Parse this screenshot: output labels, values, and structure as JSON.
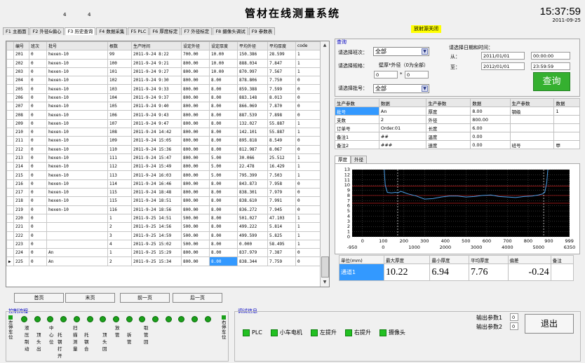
{
  "app": {
    "title": "管材在线测量系统",
    "time": "15:37:59",
    "date": "2011-09-25",
    "marks": [
      "4",
      "4"
    ],
    "radiation_status": "放射源关闭"
  },
  "tabs": [
    "F1 主画面",
    "F2 外径&偏心",
    "F3 历史查询",
    "F4 数据采集",
    "F5 PLC",
    "F6 厚度标定",
    "F7 外径标定",
    "F8 摄像头调试",
    "F9 参数表"
  ],
  "active_tab": 2,
  "grid": {
    "headers": [
      "编号",
      "班次",
      "批号",
      "根数",
      "生产时间",
      "设定外径",
      "设定厚度",
      "平均外径",
      "平均厚度",
      "code"
    ],
    "rows": [
      [
        "201",
        "0",
        "hexen-10",
        "99",
        "2011-9-24 8:22",
        "700.00",
        "10.00",
        "150.386",
        "28.599",
        "1"
      ],
      [
        "202",
        "0",
        "hexen-10",
        "100",
        "2011-9-24 9:21",
        "800.00",
        "10.00",
        "888.034",
        "7.847",
        "1"
      ],
      [
        "203",
        "0",
        "hexen-10",
        "101",
        "2011-9-24 9:27",
        "800.00",
        "10.00",
        "870.997",
        "7.567",
        "1"
      ],
      [
        "204",
        "0",
        "hexen-10",
        "102",
        "2011-9-24 9:30",
        "800.00",
        "8.00",
        "878.806",
        "7.750",
        "0"
      ],
      [
        "205",
        "0",
        "hexen-10",
        "103",
        "2011-9-24 9:33",
        "800.00",
        "8.00",
        "859.388",
        "7.599",
        "0"
      ],
      [
        "206",
        "0",
        "hexen-10",
        "104",
        "2011-9-24 9:37",
        "800.00",
        "8.00",
        "883.148",
        "8.013",
        "0"
      ],
      [
        "207",
        "0",
        "hexen-10",
        "105",
        "2011-9-24 9:40",
        "800.00",
        "8.00",
        "866.069",
        "7.870",
        "0"
      ],
      [
        "208",
        "0",
        "hexen-10",
        "106",
        "2011-9-24 9:43",
        "800.00",
        "8.00",
        "887.539",
        "7.898",
        "0"
      ],
      [
        "209",
        "0",
        "hexen-10",
        "107",
        "2011-9-24 9:47",
        "800.00",
        "8.00",
        "132.027",
        "55.887",
        "1"
      ],
      [
        "210",
        "0",
        "hexen-10",
        "108",
        "2011-9-24 14:42",
        "800.00",
        "8.00",
        "142.101",
        "55.887",
        "1"
      ],
      [
        "211",
        "0",
        "hexen-10",
        "109",
        "2011-9-24 15:05",
        "800.00",
        "8.00",
        "895.818",
        "8.549",
        "0"
      ],
      [
        "212",
        "0",
        "hexen-10",
        "110",
        "2011-9-24 15:36",
        "800.00",
        "8.00",
        "812.987",
        "8.067",
        "0"
      ],
      [
        "213",
        "0",
        "hexen-10",
        "111",
        "2011-9-24 15:47",
        "800.00",
        "5.00",
        "30.066",
        "25.512",
        "1"
      ],
      [
        "214",
        "0",
        "hexen-10",
        "112",
        "2011-9-24 15:49",
        "800.00",
        "5.00",
        "22.478",
        "16.429",
        "1"
      ],
      [
        "215",
        "0",
        "hexen-10",
        "113",
        "2011-9-24 16:03",
        "800.00",
        "5.00",
        "795.399",
        "7.503",
        "1"
      ],
      [
        "216",
        "0",
        "hexen-10",
        "114",
        "2011-9-24 16:46",
        "800.00",
        "8.00",
        "843.873",
        "7.958",
        "0"
      ],
      [
        "217",
        "0",
        "hexen-10",
        "115",
        "2011-9-24 18:48",
        "800.00",
        "8.00",
        "838.301",
        "7.979",
        "0"
      ],
      [
        "218",
        "0",
        "hexen-10",
        "115",
        "2011-9-24 18:51",
        "800.00",
        "8.00",
        "838.610",
        "7.991",
        "0"
      ],
      [
        "219",
        "0",
        "hexen-10",
        "116",
        "2011-9-24 18:56",
        "800.00",
        "8.00",
        "836.272",
        "7.945",
        "0"
      ],
      [
        "220",
        "0",
        "",
        "1",
        "2011-9-25 14:51",
        "500.00",
        "8.00",
        "501.027",
        "47.103",
        "1"
      ],
      [
        "221",
        "0",
        "",
        "2",
        "2011-9-25 14:56",
        "500.00",
        "8.00",
        "499.222",
        "5.814",
        "1"
      ],
      [
        "222",
        "0",
        "",
        "3",
        "2011-9-25 14:59",
        "500.00",
        "8.00",
        "499.599",
        "5.825",
        "1"
      ],
      [
        "223",
        "0",
        "",
        "4",
        "2011-9-25 15:02",
        "500.00",
        "8.00",
        "0.000",
        "58.495",
        "1"
      ],
      [
        "224",
        "0",
        "An",
        "1",
        "2011-9-25 15:29",
        "800.00",
        "8.00",
        "837.979",
        "7.387",
        "0"
      ],
      [
        "225",
        "0",
        "An",
        "2",
        "2011-9-25 15:34",
        "800.00",
        "8.00",
        "838.344",
        "7.759",
        "0"
      ]
    ],
    "current_indicator": "▶",
    "scroll_up": "▲",
    "scroll_down": "▼"
  },
  "pager": [
    "首页",
    "末页",
    "前一页",
    "后一页"
  ],
  "query": {
    "title": "查询",
    "shift_label": "请选择班次：",
    "shift_value": "全部",
    "spec_label": "请选择规格：",
    "spec_hint": "壁厚*外径（0为全部）",
    "spec_thickness": "0",
    "spec_times": "*",
    "spec_diameter": "0",
    "batch_label": "请选择批号：",
    "batch_value": "全部",
    "dropdown_icon": "▼",
    "date_label": "请选择日期和时间：",
    "from_label": "从：",
    "to_label": "至：",
    "from_date": "2011/01/01",
    "from_time": "00:00:00",
    "to_date": "2012/01/01",
    "to_time": "23:59:59",
    "button": "查询"
  },
  "params": {
    "headers": [
      "生产参数",
      "数据",
      "生产参数",
      "数据",
      "生产参数",
      "数据"
    ],
    "rows": [
      [
        "批号",
        "An",
        "厚度",
        "8.00",
        "钢级",
        "1"
      ],
      [
        "支数",
        "2",
        "外径",
        "800.00",
        "",
        ""
      ],
      [
        "订单号",
        "Order.01",
        "长度",
        "6.00",
        "",
        ""
      ],
      [
        "备注1",
        "##",
        "温度",
        "0.00",
        "",
        ""
      ],
      [
        "备注2",
        "###",
        "速度",
        "0.00",
        "班号",
        "甲"
      ]
    ]
  },
  "chart_tabs": [
    "厚度",
    "外径"
  ],
  "chart_data": {
    "type": "line",
    "title": "",
    "xlabel": "",
    "ylabel": "",
    "grid": true,
    "background": "#000000",
    "grid_color": "#808080",
    "line_color": "#4a9fe8",
    "limit_color": "#c02020",
    "xlim": [
      -50,
      1000
    ],
    "ylim": [
      0,
      13
    ],
    "top_ticks": [
      0,
      100,
      200,
      300,
      400,
      500,
      600,
      700,
      800,
      900,
      999
    ],
    "bottom_ticks": [
      "-950",
      "0",
      "1000",
      "2000",
      "3000",
      "4000",
      "5000",
      "6350"
    ],
    "y_ticks": [
      0,
      1,
      2,
      3,
      4,
      5,
      6,
      7,
      8,
      9,
      10,
      11,
      12,
      13
    ],
    "markers_x": [
      170,
      875
    ],
    "limits_y": [
      9.8,
      8.0,
      6.5
    ],
    "x": [
      105,
      110,
      120,
      140,
      160,
      170,
      185,
      200,
      220,
      260,
      300,
      340,
      380,
      420,
      460,
      500,
      540,
      580,
      620,
      660,
      700,
      740,
      780,
      820,
      850,
      870,
      880,
      890,
      895
    ],
    "y": [
      13.0,
      10.0,
      8.6,
      8.5,
      8.6,
      8.5,
      8.8,
      8.6,
      8.3,
      7.9,
      7.3,
      7.4,
      7.7,
      7.9,
      7.9,
      7.7,
      7.8,
      8.0,
      8.1,
      7.8,
      7.7,
      7.6,
      7.8,
      7.9,
      8.1,
      8.3,
      8.6,
      10.5,
      13.0
    ]
  },
  "summary": {
    "headers": [
      "单位(mm)",
      "最大厚度",
      "最小厚度",
      "平均厚度",
      "偏差",
      "备注"
    ],
    "row": [
      "通道1",
      "10.22",
      "6.94",
      "7.76",
      "-0.24",
      ""
    ]
  },
  "control": {
    "title": "控制流程",
    "left_stop": "左停车位",
    "right_stop": "右停车位",
    "labels": [
      "液压制动",
      "顶头出",
      "中心位",
      "托钢打开",
      "扫描测量",
      "托钢合",
      "顶头回",
      "放管",
      "拆管",
      "取管回"
    ]
  },
  "debug": {
    "title": "调试信息",
    "items": [
      "PLC",
      "小车电机",
      "左提升",
      "右提升",
      "摄像头"
    ]
  },
  "outputs": {
    "label1": "输出参数1",
    "value1": "0",
    "label2": "输出参数2",
    "value2": "0"
  },
  "exit_label": "退出"
}
